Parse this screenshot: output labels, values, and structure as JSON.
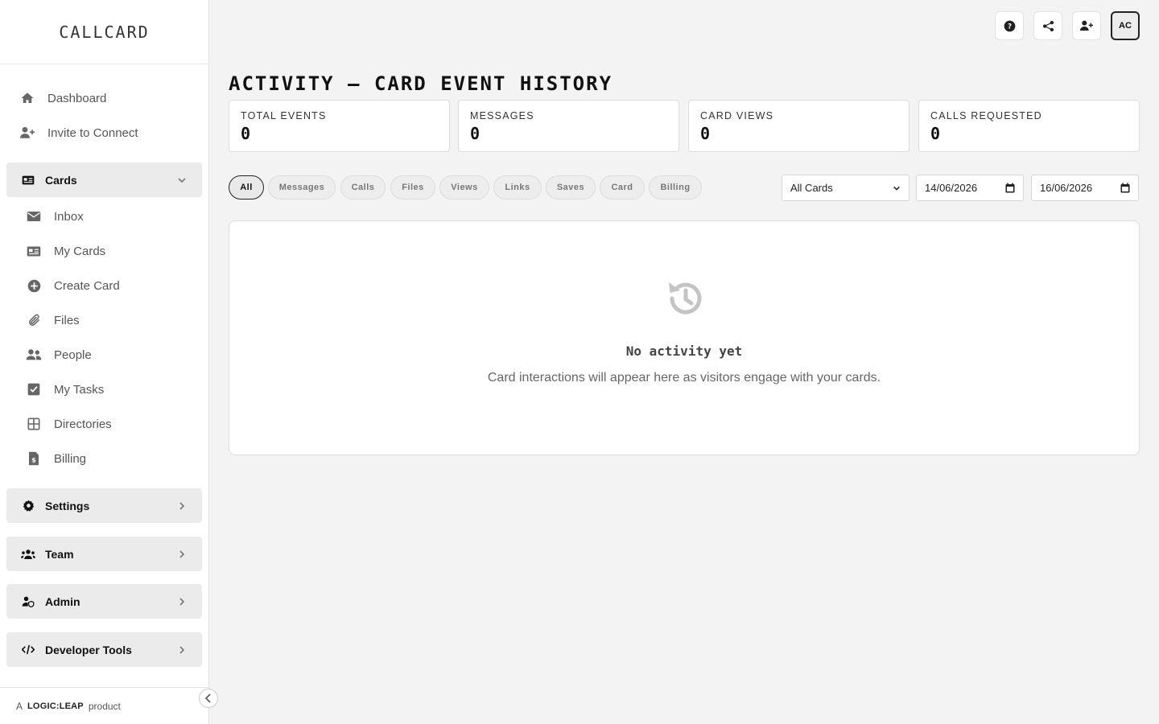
{
  "brand": {
    "logo": "CALLCARD",
    "footer_prefix": "A",
    "footer_brand": "LOGIC:LEAP",
    "footer_suffix": "product"
  },
  "sidebar": {
    "top_items": [
      {
        "label": "Dashboard",
        "icon": "home-icon"
      },
      {
        "label": "Invite to Connect",
        "icon": "user-plus-icon"
      }
    ],
    "cards_group": {
      "label": "Cards",
      "icon": "id-card-icon",
      "expanded": true
    },
    "cards_items": [
      {
        "label": "Inbox",
        "icon": "envelope-icon"
      },
      {
        "label": "My Cards",
        "icon": "id-card-icon"
      },
      {
        "label": "Create Card",
        "icon": "plus-circle-icon"
      },
      {
        "label": "Files",
        "icon": "paperclip-icon"
      },
      {
        "label": "People",
        "icon": "users-icon"
      },
      {
        "label": "My Tasks",
        "icon": "checkbox-icon"
      },
      {
        "label": "Directories",
        "icon": "grid-icon"
      },
      {
        "label": "Billing",
        "icon": "invoice-icon"
      }
    ],
    "groups": [
      {
        "label": "Settings",
        "icon": "gear-icon"
      },
      {
        "label": "Team",
        "icon": "team-icon"
      },
      {
        "label": "Admin",
        "icon": "user-shield-icon"
      },
      {
        "label": "Developer Tools",
        "icon": "code-icon"
      }
    ]
  },
  "topbar": {
    "avatar_initials": "AC"
  },
  "page": {
    "title": "ACTIVITY — CARD EVENT HISTORY"
  },
  "stats": [
    {
      "label": "TOTAL EVENTS",
      "value": "0"
    },
    {
      "label": "MESSAGES",
      "value": "0"
    },
    {
      "label": "CARD VIEWS",
      "value": "0"
    },
    {
      "label": "CALLS REQUESTED",
      "value": "0"
    }
  ],
  "filters": {
    "pills": [
      "All",
      "Messages",
      "Calls",
      "Files",
      "Views",
      "Links",
      "Saves",
      "Card",
      "Billing"
    ],
    "active": "All",
    "card_select": "All Cards",
    "date_from": "14/06/2026",
    "date_to": "16/06/2026"
  },
  "empty_state": {
    "title": "No activity yet",
    "text": "Card interactions will appear here as visitors engage with your cards."
  },
  "colors": {
    "accent": "#222222",
    "background": "#f3f3f3",
    "surface": "#ffffff"
  }
}
